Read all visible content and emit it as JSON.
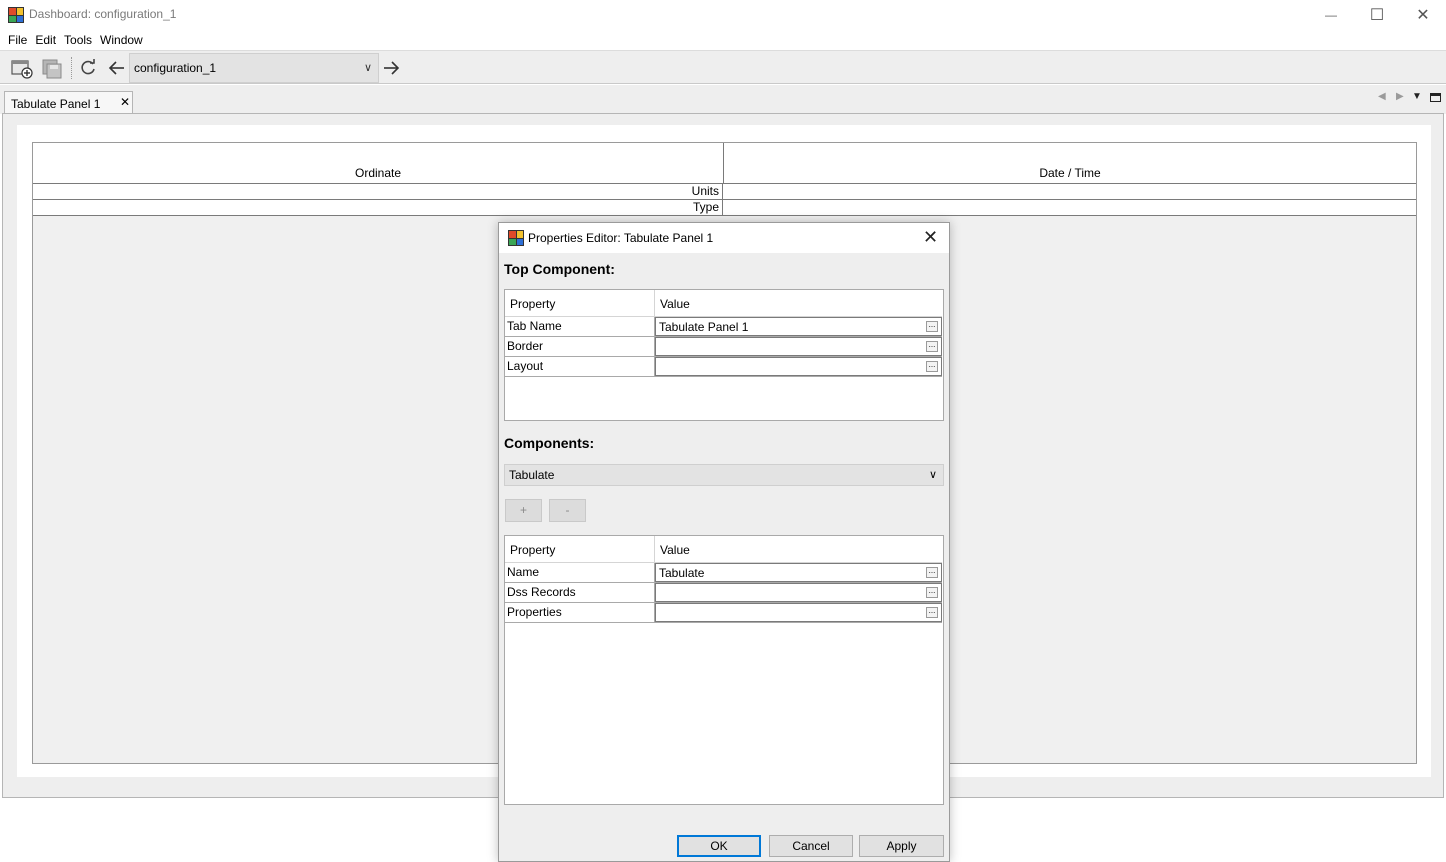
{
  "window": {
    "title": "Dashboard: configuration_1",
    "minimize_glyph": "—",
    "maximize_glyph": "☐",
    "close_glyph": "✕"
  },
  "menu": [
    "File",
    "Edit",
    "Tools",
    "Window"
  ],
  "toolbar": {
    "new_icon": "new-dashboard-icon",
    "save_icon": "save-icon",
    "refresh_icon": "refresh-icon",
    "back_icon": "arrow-left-icon",
    "forward_icon": "arrow-right-icon",
    "configuration_value": "configuration_1"
  },
  "tabs": [
    {
      "label": "Tabulate Panel 1",
      "close_glyph": "✕"
    }
  ],
  "table": {
    "columns": [
      "Ordinate",
      "Date / Time"
    ],
    "sub_rows": [
      "Units",
      "Type"
    ]
  },
  "dialog": {
    "title": "Properties Editor: Tabulate Panel 1",
    "top_component_label": "Top Component:",
    "top_table": {
      "headers": [
        "Property",
        "Value"
      ],
      "rows": [
        {
          "property": "Tab Name",
          "value": "Tabulate Panel 1"
        },
        {
          "property": "Border",
          "value": ""
        },
        {
          "property": "Layout",
          "value": ""
        }
      ]
    },
    "components_label": "Components:",
    "components_select": "Tabulate",
    "add_label": "+",
    "remove_label": "-",
    "components_table": {
      "headers": [
        "Property",
        "Value"
      ],
      "rows": [
        {
          "property": "Name",
          "value": "Tabulate"
        },
        {
          "property": "Dss Records",
          "value": ""
        },
        {
          "property": "Properties",
          "value": ""
        }
      ]
    },
    "ok_label": "OK",
    "cancel_label": "Cancel",
    "apply_label": "Apply",
    "ellipsis_label": "..."
  }
}
